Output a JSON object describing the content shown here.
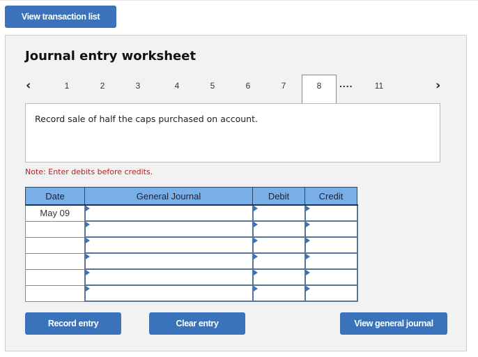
{
  "top_button": {
    "label": "View transaction list"
  },
  "worksheet": {
    "title": "Journal entry worksheet",
    "nav": {
      "prev_icon": "chevron-left-icon",
      "next_icon": "chevron-right-icon",
      "tabs": [
        "1",
        "2",
        "3",
        "4",
        "5",
        "6",
        "7",
        "8",
        "11"
      ],
      "active_tab": "8",
      "ellipsis": "...."
    },
    "description": "Record sale of half the caps purchased on account.",
    "note": "Note: Enter debits before credits.",
    "table": {
      "headers": [
        "Date",
        "General Journal",
        "Debit",
        "Credit"
      ],
      "rows": [
        {
          "date": "May 09",
          "account": "",
          "debit": "",
          "credit": ""
        },
        {
          "date": "",
          "account": "",
          "debit": "",
          "credit": ""
        },
        {
          "date": "",
          "account": "",
          "debit": "",
          "credit": ""
        },
        {
          "date": "",
          "account": "",
          "debit": "",
          "credit": ""
        },
        {
          "date": "",
          "account": "",
          "debit": "",
          "credit": ""
        },
        {
          "date": "",
          "account": "",
          "debit": "",
          "credit": ""
        }
      ]
    },
    "buttons": {
      "record": "Record entry",
      "clear": "Clear entry",
      "view_journal": "View general journal"
    }
  },
  "colors": {
    "button_blue": "#3a73b9",
    "header_blue": "#79aee6",
    "note_red": "#b22222"
  }
}
